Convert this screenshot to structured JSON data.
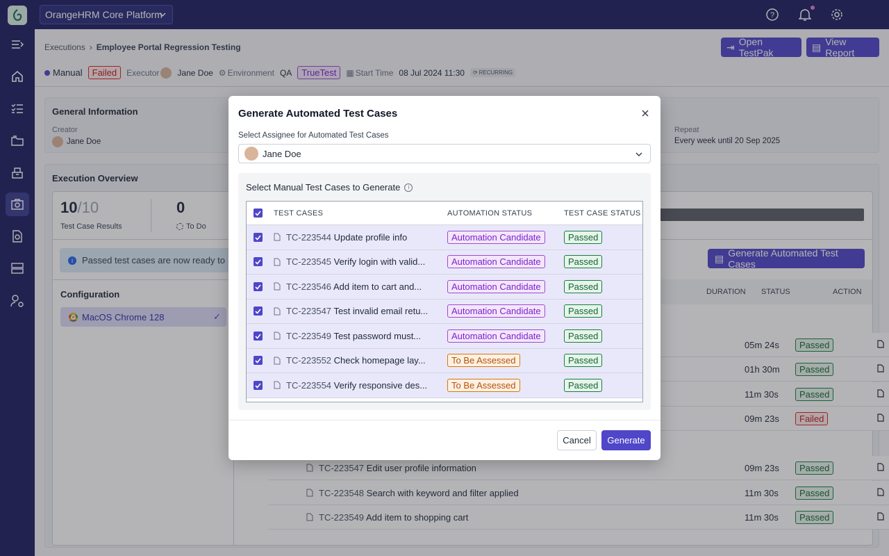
{
  "topbar": {
    "project": "OrangeHRM Core Platform"
  },
  "breadcrumb": {
    "root": "Executions",
    "current": "Employee Portal Regression Testing"
  },
  "header_buttons": {
    "open_testpak": "Open TestPak",
    "view_report": "View Report"
  },
  "meta": {
    "type": "Manual",
    "status": "Failed",
    "executor_label": "Executor",
    "executor": "Jane Doe",
    "environment_label": "Environment",
    "environment": "QA",
    "tool": "TrueTest",
    "start_label": "Start Time",
    "start_time": "08 Jul 2024 11:30",
    "recurring": "RECURRING"
  },
  "general": {
    "title": "General Information",
    "creator_label": "Creator",
    "creator": "Jane Doe",
    "repeat_label": "Repeat",
    "repeat": "Every week until 20 Sep 2025"
  },
  "overview": {
    "title": "Execution Overview",
    "results_done": "10",
    "results_total": "/10",
    "results_label": "Test Case Results",
    "todo_count": "0",
    "todo_label": "To Do",
    "notice": "Passed test cases are now ready to",
    "generate_button": "Generate Automated Test Cases",
    "config_title": "Configuration",
    "config_item": "MacOS Chrome 128",
    "columns": {
      "duration": "DURATION",
      "status": "STATUS",
      "action": "ACTION"
    },
    "rows": [
      {
        "id": "",
        "name": "",
        "duration": "05m 24s",
        "status": "Passed"
      },
      {
        "id": "",
        "name": "",
        "duration": "01h 30m",
        "status": "Passed"
      },
      {
        "id": "",
        "name": "",
        "duration": "11m 30s",
        "status": "Passed"
      },
      {
        "id": "",
        "name": "",
        "duration": "09m 23s",
        "status": "Failed"
      },
      {
        "id": "TC-223547",
        "name": "Edit user profile information",
        "duration": "09m 23s",
        "status": "Passed"
      },
      {
        "id": "TC-223548",
        "name": "Search with keyword and filter applied",
        "duration": "11m 30s",
        "status": "Passed"
      },
      {
        "id": "TC-223549",
        "name": "Add item to shopping cart",
        "duration": "11m 30s",
        "status": "Passed"
      }
    ]
  },
  "modal": {
    "title": "Generate Automated Test Cases",
    "assignee_label": "Select Assignee for Automated Test Cases",
    "assignee": "Jane Doe",
    "section_title": "Select Manual Test Cases to Generate",
    "columns": {
      "test_cases": "TEST CASES",
      "automation_status": "AUTOMATION STATUS",
      "test_case_status": "TEST CASE STATUS"
    },
    "rows": [
      {
        "id": "TC-223544",
        "name": "Update profile info",
        "automation": "Automation Candidate",
        "status": "Passed"
      },
      {
        "id": "TC-223545",
        "name": "Verify login with valid...",
        "automation": "Automation Candidate",
        "status": "Passed"
      },
      {
        "id": "TC-223546",
        "name": "Add item to cart and...",
        "automation": "Automation Candidate",
        "status": "Passed"
      },
      {
        "id": "TC-223547",
        "name": "Test invalid email retu...",
        "automation": "Automation Candidate",
        "status": "Passed"
      },
      {
        "id": "TC-223549",
        "name": "Test password must...",
        "automation": "Automation Candidate",
        "status": "Passed"
      },
      {
        "id": "TC-223552",
        "name": "Check homepage lay...",
        "automation": "To Be Assessed",
        "status": "Passed"
      },
      {
        "id": "TC-223554",
        "name": "Verify responsive des...",
        "automation": "To Be Assessed",
        "status": "Passed"
      }
    ],
    "cancel": "Cancel",
    "generate": "Generate"
  },
  "colors": {
    "brand": "#1f2063",
    "accent": "#4f46c8",
    "passed": "#166534",
    "failed": "#b91c1c",
    "candidate": "#7e22ce",
    "assess": "#b45309"
  }
}
